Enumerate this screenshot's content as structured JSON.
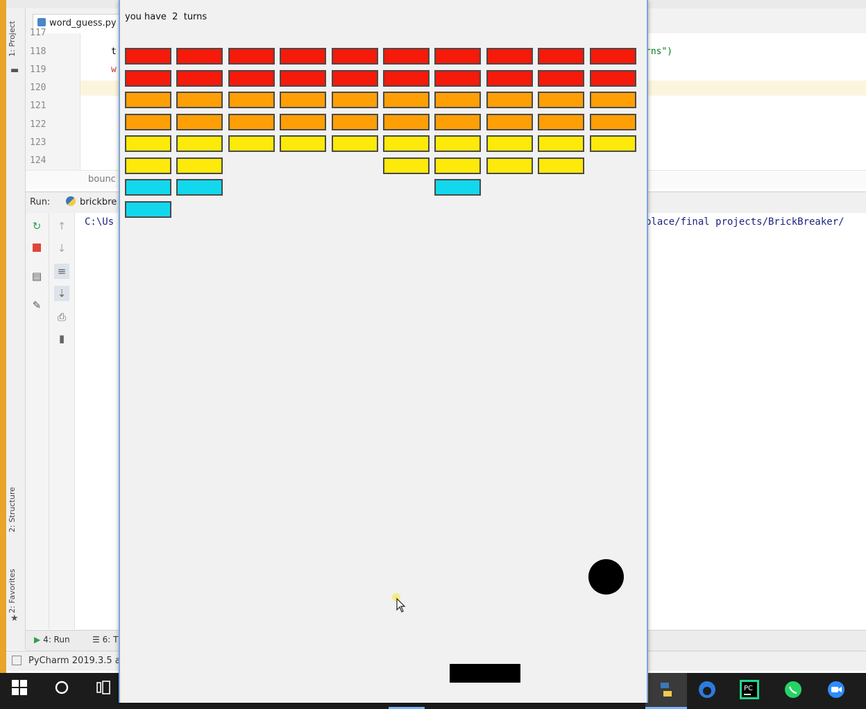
{
  "ide": {
    "left_tabs": [
      "1: Project",
      "2: Structure",
      "2: Favorites"
    ],
    "file_tab": "word_guess.py",
    "line_numbers": [
      "117",
      "118",
      "119",
      "120",
      "121",
      "122",
      "123",
      "124"
    ],
    "current_line": "120",
    "code_fragments": {
      "line118_left": "t",
      "line119_left": "w",
      "line118_right": "rns\")"
    },
    "breadcrumb": "bounc",
    "run_label": "Run:",
    "run_tab": "brickbre",
    "console_left": "C:\\Us",
    "console_right": "place/final projects/BrickBreaker/",
    "bottom_tabs": [
      "4: Run",
      "6: T"
    ],
    "status": "PyCharm 2019.3.5 a"
  },
  "game": {
    "turns_text": "you have  2  turns",
    "brick_rows": [
      {
        "color": "#f51a0a",
        "columns": [
          0,
          1,
          2,
          3,
          4,
          5,
          6,
          7,
          8,
          9
        ]
      },
      {
        "color": "#f51a0a",
        "columns": [
          0,
          1,
          2,
          3,
          4,
          5,
          6,
          7,
          8,
          9
        ]
      },
      {
        "color": "#ff9f06",
        "columns": [
          0,
          1,
          2,
          3,
          4,
          5,
          6,
          7,
          8,
          9
        ]
      },
      {
        "color": "#ff9f06",
        "columns": [
          0,
          1,
          2,
          3,
          4,
          5,
          6,
          7,
          8,
          9
        ]
      },
      {
        "color": "#fde90a",
        "columns": [
          0,
          1,
          2,
          3,
          4,
          5,
          6,
          7,
          8,
          9
        ]
      },
      {
        "color": "#fde90a",
        "columns": [
          0,
          1,
          5,
          6,
          7,
          8
        ]
      },
      {
        "color": "#12d8ee",
        "columns": [
          0,
          1,
          6
        ]
      },
      {
        "color": "#12d8ee",
        "columns": [
          0
        ]
      }
    ],
    "ball_color": "#000000",
    "paddle_color": "#000000"
  },
  "taskbar": {
    "icons": [
      "windows-start-icon",
      "cortana-icon",
      "task-view-icon",
      "python-icon",
      "browser-icon",
      "pycharm-icon",
      "whatsapp-icon",
      "zoom-icon"
    ]
  }
}
